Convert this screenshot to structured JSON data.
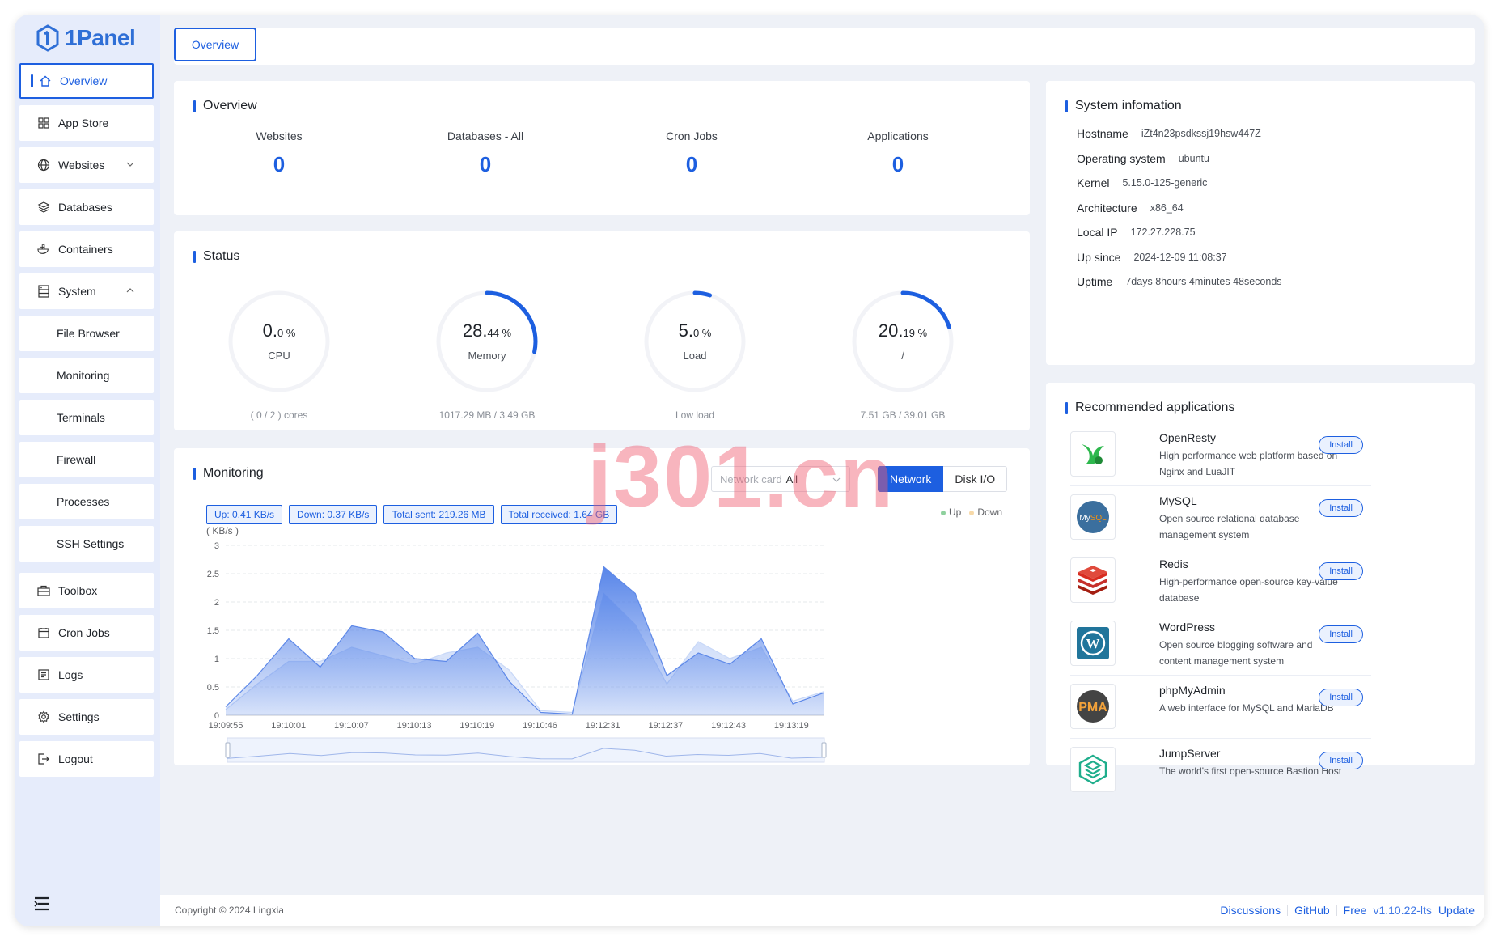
{
  "brand": {
    "name": "1Panel"
  },
  "sidebar": {
    "items": [
      {
        "label": "Overview"
      },
      {
        "label": "App Store"
      },
      {
        "label": "Websites"
      },
      {
        "label": "Databases"
      },
      {
        "label": "Containers"
      },
      {
        "label": "System"
      },
      {
        "label": "File Browser"
      },
      {
        "label": "Monitoring"
      },
      {
        "label": "Terminals"
      },
      {
        "label": "Firewall"
      },
      {
        "label": "Processes"
      },
      {
        "label": "SSH Settings"
      },
      {
        "label": "Toolbox"
      },
      {
        "label": "Cron Jobs"
      },
      {
        "label": "Logs"
      },
      {
        "label": "Settings"
      },
      {
        "label": "Logout"
      }
    ]
  },
  "tabs": {
    "overview": "Overview"
  },
  "overview_card": {
    "title": "Overview",
    "stats": [
      {
        "label": "Websites",
        "value": "0"
      },
      {
        "label": "Databases - All",
        "value": "0"
      },
      {
        "label": "Cron Jobs",
        "value": "0"
      },
      {
        "label": "Applications",
        "value": "0"
      }
    ]
  },
  "status_card": {
    "title": "Status",
    "gauges": [
      {
        "int": "0.",
        "dec": "0 %",
        "name": "CPU",
        "foot": "( 0 / 2 ) cores",
        "percent": 0
      },
      {
        "int": "28.",
        "dec": "44 %",
        "name": "Memory",
        "foot": "1017.29 MB / 3.49 GB",
        "percent": 28.44
      },
      {
        "int": "5.",
        "dec": "0 %",
        "name": "Load",
        "foot": "Low load",
        "percent": 5
      },
      {
        "int": "20.",
        "dec": "19 %",
        "name": "/",
        "foot": "7.51 GB / 39.01 GB",
        "percent": 20.19
      }
    ]
  },
  "monitoring": {
    "title": "Monitoring",
    "badges": {
      "up": "Up: 0.41 KB/s",
      "down": "Down: 0.37 KB/s",
      "sent": "Total sent: 219.26 MB",
      "received": "Total received: 1.64 GB"
    },
    "network_card_label": "Network card",
    "network_card_value": "All",
    "seg_network": "Network",
    "seg_disk": "Disk I/O",
    "legend_up": "Up",
    "legend_down": "Down",
    "unit_label": "( KB/s )"
  },
  "chart_data": {
    "type": "area",
    "ylabel": "( KB/s )",
    "ylim": [
      0,
      3
    ],
    "yticks": [
      "0",
      "0.5",
      "1",
      "1.5",
      "2",
      "2.5",
      "3"
    ],
    "x_labels": [
      "19:09:55",
      "19:10:01",
      "19:10:07",
      "19:10:13",
      "19:10:19",
      "19:10:46",
      "19:12:31",
      "19:12:37",
      "19:12:43",
      "19:13:19"
    ],
    "series": [
      {
        "name": "Up",
        "values": [
          0.15,
          0.7,
          1.35,
          0.85,
          1.58,
          1.47,
          1.0,
          0.95,
          1.45,
          0.6,
          0.05,
          0.02,
          2.62,
          2.15,
          0.7,
          1.1,
          0.9,
          1.35,
          0.2,
          0.4
        ]
      },
      {
        "name": "Down",
        "values": [
          0.1,
          0.55,
          0.95,
          0.95,
          1.2,
          1.05,
          0.9,
          1.1,
          1.2,
          0.8,
          0.08,
          0.05,
          2.15,
          1.6,
          0.55,
          1.3,
          1.0,
          1.2,
          0.25,
          0.42
        ]
      }
    ]
  },
  "system_info": {
    "title": "System infomation",
    "rows": [
      {
        "key": "Hostname",
        "value": "iZt4n23psdkssj19hsw447Z"
      },
      {
        "key": "Operating system",
        "value": "ubuntu"
      },
      {
        "key": "Kernel",
        "value": "5.15.0-125-generic"
      },
      {
        "key": "Architecture",
        "value": "x86_64"
      },
      {
        "key": "Local IP",
        "value": "172.27.228.75"
      },
      {
        "key": "Up since",
        "value": "2024-12-09 11:08:37"
      },
      {
        "key": "Uptime",
        "value": "7days 8hours 4minutes 48seconds"
      }
    ]
  },
  "recommended": {
    "title": "Recommended applications",
    "install_label": "Install",
    "apps": [
      {
        "name": "OpenResty",
        "desc": "High performance web platform based on Nginx and LuaJIT"
      },
      {
        "name": "MySQL",
        "desc": "Open source relational database management system"
      },
      {
        "name": "Redis",
        "desc": "High-performance open-source key-value database"
      },
      {
        "name": "WordPress",
        "desc": "Open source blogging software and content management system"
      },
      {
        "name": "phpMyAdmin",
        "desc": "A web interface for MySQL and MariaDB"
      },
      {
        "name": "JumpServer",
        "desc": "The world's first open-source Bastion Host"
      }
    ]
  },
  "footer": {
    "copyright": "Copyright © 2024 Lingxia",
    "discussions": "Discussions",
    "github": "GitHub",
    "free": "Free",
    "version": "v1.10.22-lts",
    "update": "Update"
  },
  "watermark": "j301.cn",
  "colors": {
    "accent": "#1d5fe0",
    "up_series": "#4f7fe8",
    "down_series": "#b9cdf6"
  }
}
